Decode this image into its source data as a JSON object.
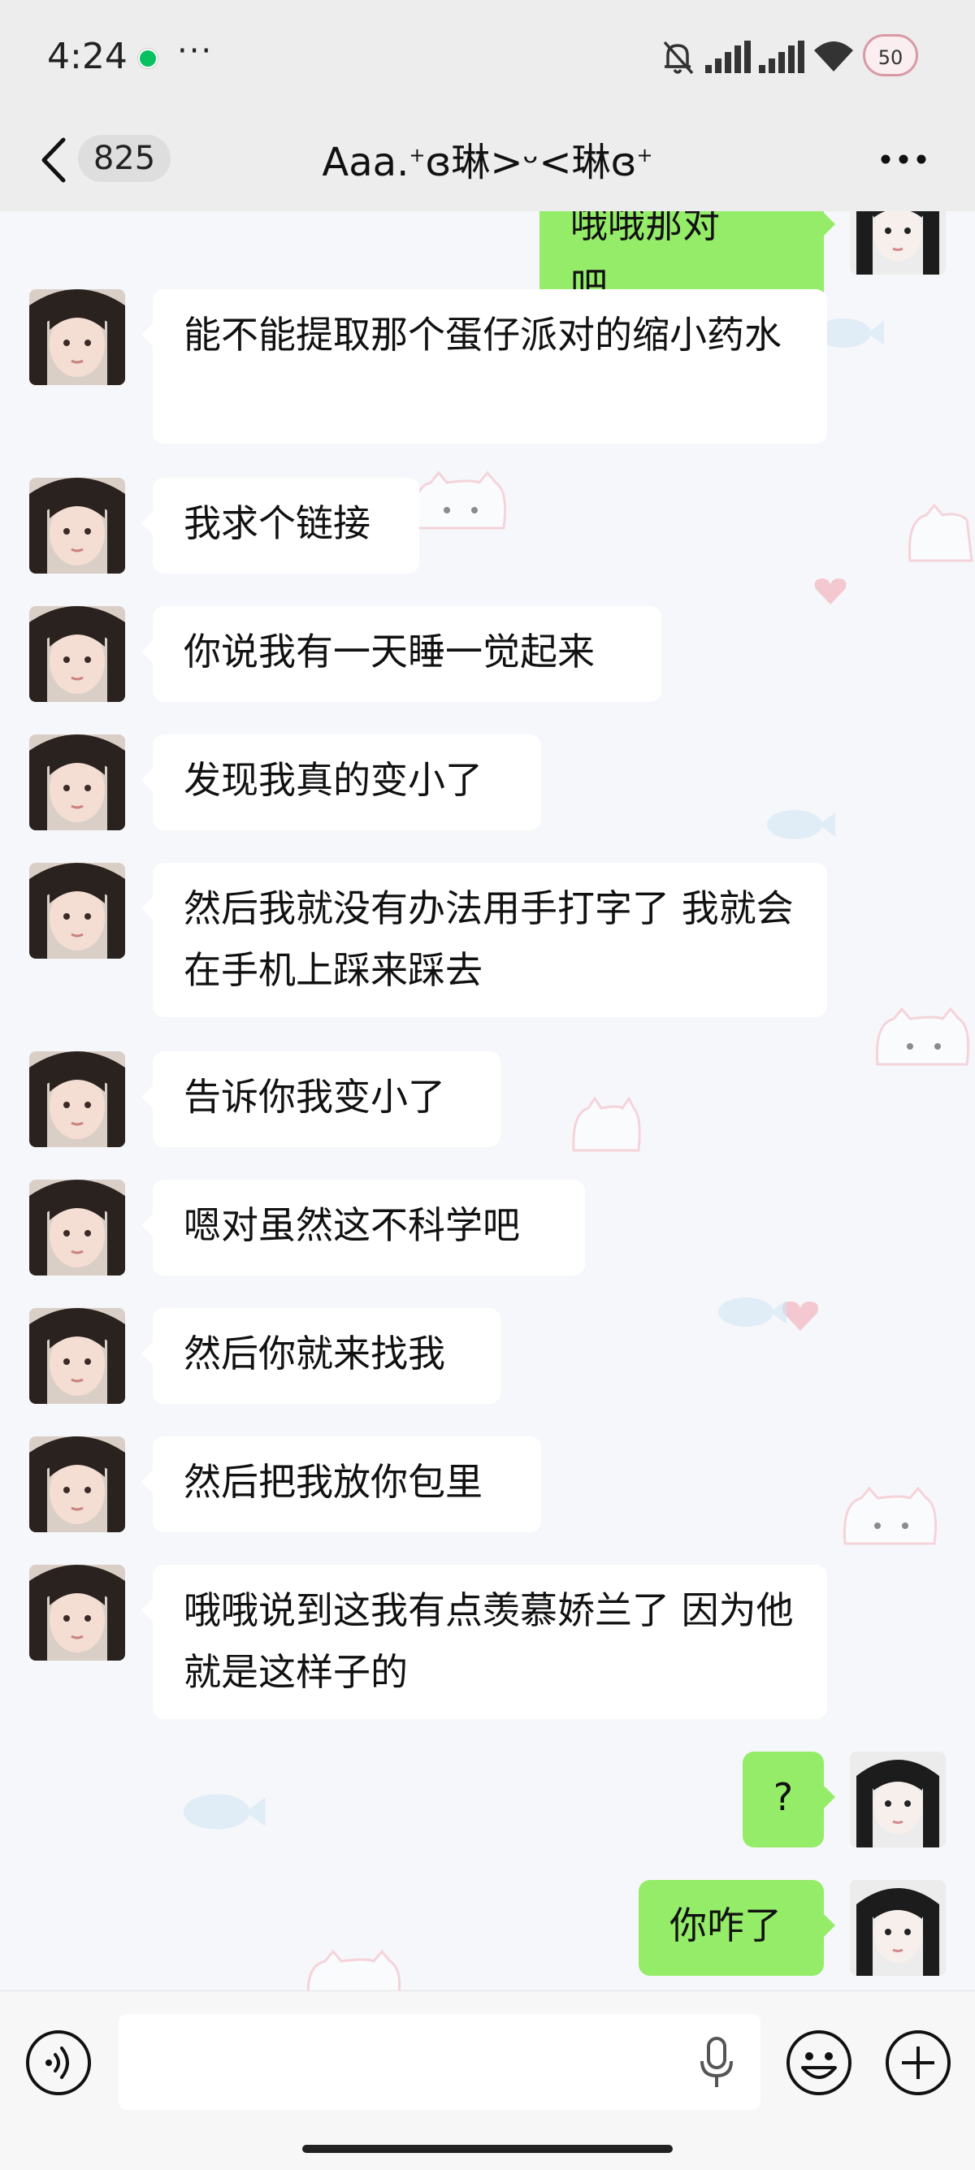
{
  "status_bar": {
    "time": "4:24",
    "dots": "···",
    "battery": "50"
  },
  "nav": {
    "unread_count": "825",
    "title_main": "Aaa.",
    "title_plus1": "+",
    "title_rest": "ɞ琳>ᵕ<琳ɞ",
    "title_plus2": "+"
  },
  "messages": [
    {
      "side": "out",
      "text": "哦哦那对吧。"
    },
    {
      "side": "in",
      "text": "能不能提取那个蛋仔派对的缩小药水"
    },
    {
      "side": "in",
      "text": "我求个链接"
    },
    {
      "side": "in",
      "text": "你说我有一天睡一觉起来"
    },
    {
      "side": "in",
      "text": "发现我真的变小了"
    },
    {
      "side": "in",
      "text": "然后我就没有办法用手打字了 我就会在手机上踩来踩去"
    },
    {
      "side": "in",
      "text": "告诉你我变小了"
    },
    {
      "side": "in",
      "text": "嗯对虽然这不科学吧"
    },
    {
      "side": "in",
      "text": "然后你就来找我"
    },
    {
      "side": "in",
      "text": "然后把我放你包里"
    },
    {
      "side": "in",
      "text": "哦哦说到这我有点羡慕娇兰了 因为他就是这样子的"
    },
    {
      "side": "out",
      "text": "?"
    },
    {
      "side": "out",
      "text": "你咋了"
    }
  ],
  "input": {
    "placeholder": ""
  },
  "colors": {
    "outgoing_bubble": "#95ec69",
    "incoming_bubble": "#ffffff",
    "bar_bg": "#ededed"
  }
}
